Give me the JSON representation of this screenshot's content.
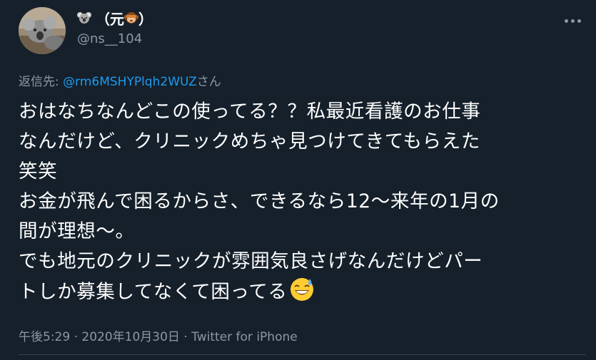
{
  "user": {
    "display_name_prefix": "（元",
    "display_name_suffix": "）",
    "handle": "@ns__104",
    "avatar_icon": "koala-avatar",
    "name_icons": [
      "koala-icon",
      "see-no-evil-monkey-icon"
    ]
  },
  "reply": {
    "label": "返信先: ",
    "mention": "@rm6MSHYPlqh2WUZ",
    "suffix": "さん"
  },
  "tweet": {
    "text": "おはなちなんどこの使ってる？？私最近看護のお仕事\nなんだけど、クリニックめちゃ見つけてきてもらえた\n笑笑\nお金が飛んで困るからさ、できるなら12〜来年の1月の\n間が理想〜。\nでも地元のクリニックが雰囲気良さげなんだけどパー\nトしか募集してなくて困ってる",
    "trailing_emoji": "grinning-sweat-icon"
  },
  "meta": {
    "time": "午後5:29",
    "sep1": " · ",
    "date": "2020年10月30日",
    "sep2": " · ",
    "source": "Twitter for iPhone"
  },
  "colors": {
    "background": "#15202b",
    "text": "#ffffff",
    "secondary": "#8b98a5",
    "link": "#1d9bf0"
  }
}
